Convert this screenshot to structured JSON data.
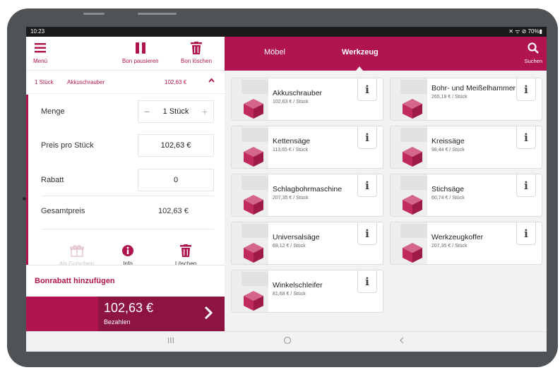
{
  "status": {
    "time": "10:23",
    "icons": "✕ ᯤ ⊘ 70%▮"
  },
  "toolbar": {
    "menu_label": "Menü",
    "pause_label": "Bon pausieren",
    "delete_label": "Bon löschen"
  },
  "item_header": {
    "qty": "1 Stück",
    "name": "Akkuschrauber",
    "price": "102,63 €"
  },
  "detail": {
    "menge_label": "Menge",
    "menge_value": "1 Stück",
    "preis_label": "Preis pro Stück",
    "preis_value": "102,63 €",
    "rabatt_label": "Rabatt",
    "rabatt_value": "0",
    "gesamt_label": "Gesamtpreis",
    "gesamt_value": "102,63 €"
  },
  "actions": {
    "voucher_label": "Als Gutschein",
    "info_label": "Info",
    "delete_label": "Löschen"
  },
  "bonrabatt_label": "Bonrabatt hinzufügen",
  "pay": {
    "amount": "102,63 €",
    "label": "Bezahlen"
  },
  "nav": {
    "tab_moebel": "Möbel",
    "tab_werkzeug": "Werkzeug",
    "search_label": "Suchen"
  },
  "products": [
    {
      "name": "Akkuschrauber",
      "price": "102,63 € / Stück"
    },
    {
      "name": "Bohr- und Meißelhammer",
      "price": "265,19 € / Stück"
    },
    {
      "name": "Kettensäge",
      "price": "113,65 € / Stück"
    },
    {
      "name": "Kreissäge",
      "price": "98,44 € / Stück"
    },
    {
      "name": "Schlagbohrmaschine",
      "price": "207,35 € / Stück"
    },
    {
      "name": "Stichsäge",
      "price": "60,74 € / Stück"
    },
    {
      "name": "Universalsäge",
      "price": "69,12 € / Stück"
    },
    {
      "name": "Werkzeugkoffer",
      "price": "207,35 € / Stück"
    },
    {
      "name": "Winkelschleifer",
      "price": "81,68 € / Stück"
    }
  ],
  "colors": {
    "accent": "#b0154f",
    "accent_dark": "#8d1441"
  }
}
